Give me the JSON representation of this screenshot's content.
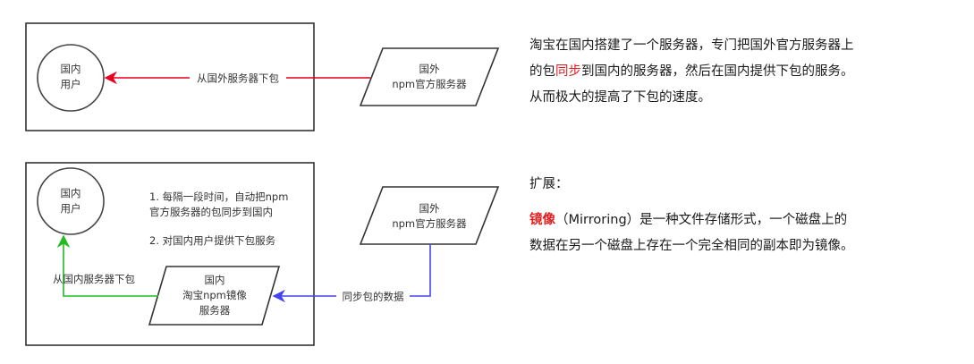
{
  "diagram_top": {
    "user_node": [
      "国内",
      "用户"
    ],
    "server_node": [
      "国外",
      "npm官方服务器"
    ],
    "arrow_label": "从国外服务器下包"
  },
  "diagram_bottom": {
    "user_node": [
      "国内",
      "用户"
    ],
    "server_node": [
      "国外",
      "npm官方服务器"
    ],
    "mirror_node": [
      "国内",
      "淘宝npm镜像",
      "服务器"
    ],
    "notes": [
      "1. 每隔一段时间，自动把npm",
      "官方服务器的包同步到国内",
      "2. 对国内用户提供下包服务"
    ],
    "download_label": "从国内服务器下包",
    "sync_label": "同步包的数据"
  },
  "description": {
    "line1": "淘宝在国内搭建了一个服务器，专门把国外官方服务器上",
    "line2_before": "的包",
    "line2_highlight": "同步",
    "line2_after": "到国内的服务器，然后在国内提供下包的服务。",
    "line3": "从而极大的提高了下包的速度。"
  },
  "extension": {
    "label": "扩展：",
    "term": "镜像",
    "line1_rest": "（Mirroring）是一种文件存储形式，一个磁盘上的",
    "line2": "数据在另一个磁盘上存在一个完全相同的副本即为镜像。"
  },
  "colors": {
    "red_arrow": "#e8001c",
    "green_arrow": "#22bb22",
    "blue_arrow": "#4444ee",
    "highlight": "#e02020"
  }
}
